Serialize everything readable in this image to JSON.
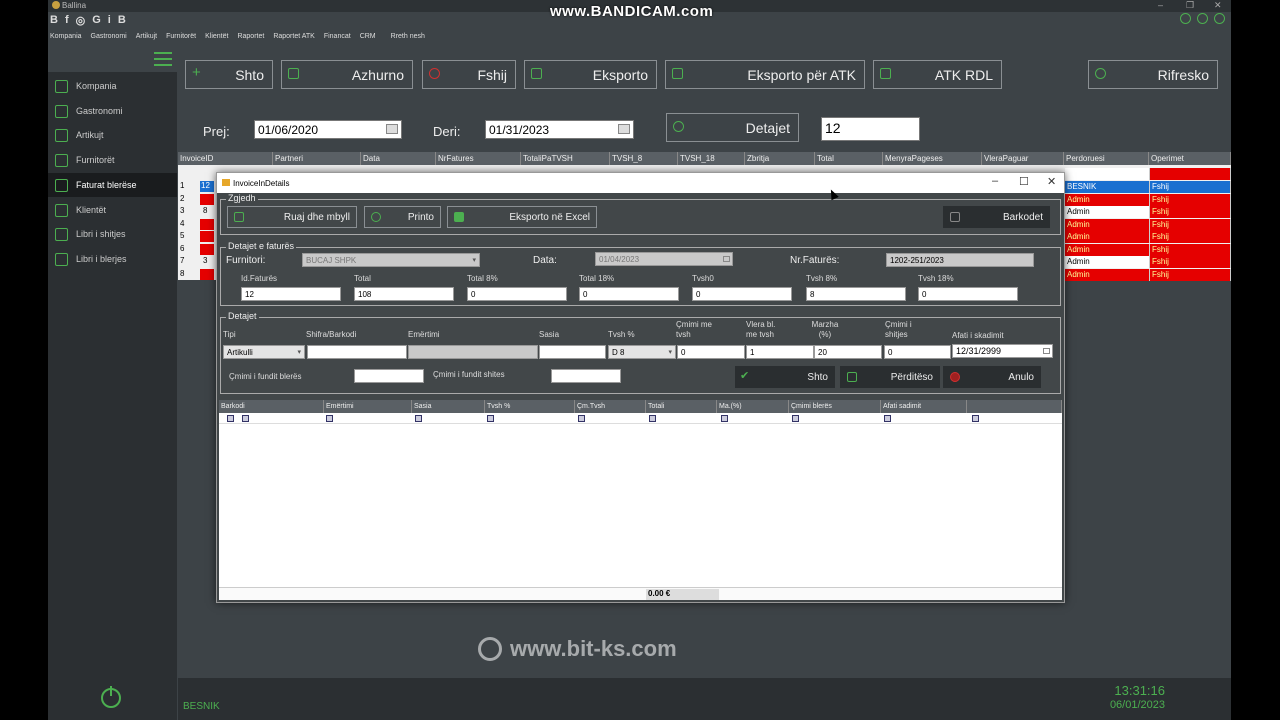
{
  "window": {
    "title": "Ballina"
  },
  "recording_watermark": "www.BANDICAM.com",
  "site_watermark": "www.bit-ks.com",
  "menubar": [
    "Kompania",
    "Gastronomi",
    "Artikujt",
    "Furnitorët",
    "Klientët",
    "Raportet",
    "Raportet ATK",
    "Financat",
    "CRM",
    "Rreth nesh"
  ],
  "social_icons": [
    "B",
    "f",
    "◎",
    "G",
    "i",
    "B"
  ],
  "sidebar": {
    "items": [
      {
        "label": "Kompania"
      },
      {
        "label": "Gastronomi"
      },
      {
        "label": "Artikujt"
      },
      {
        "label": "Furnitorët"
      },
      {
        "label": "Faturat blerëse"
      },
      {
        "label": "Klientët"
      },
      {
        "label": "Libri i shitjes"
      },
      {
        "label": "Libri i blerjes"
      }
    ],
    "active_index": 4
  },
  "toolbar": {
    "add": "Shto",
    "update": "Azhurno",
    "delete": "Fshij",
    "export": "Eksporto",
    "export_atk": "Eksporto për ATK",
    "atk_rdl": "ATK RDL",
    "refresh": "Rifresko"
  },
  "filter": {
    "from_label": "Prej:",
    "from_value": "01/06/2020",
    "to_label": "Deri:",
    "to_value": "01/31/2023",
    "details_button": "Detajet",
    "count_value": "12"
  },
  "main_grid": {
    "columns": [
      "InvoiceID",
      "Partneri",
      "Data",
      "NrFatures",
      "TotaliPaTVSH",
      "TVSH_8",
      "TVSH_18",
      "Zbritja",
      "Total",
      "MenyraPageses",
      "VleraPaguar",
      "Perdoruesi",
      "Operimet"
    ],
    "row_numbers": [
      "1",
      "2",
      "3",
      "4",
      "5",
      "6",
      "7",
      "8"
    ],
    "visible_ids": [
      "12",
      "",
      "8",
      "",
      "",
      "",
      "3",
      ""
    ],
    "users": [
      "BESNIK",
      "Admin",
      "Admin",
      "Admin",
      "Admin",
      "Admin",
      "Admin",
      "Admin"
    ],
    "operations": [
      "Fshij",
      "Fshij",
      "Fshij",
      "Fshij",
      "Fshij",
      "Fshij",
      "Fshij",
      "Fshij"
    ]
  },
  "dialog": {
    "title": "InvoiceInDetails",
    "group_choose": "Zgjedh",
    "save_close": "Ruaj dhe mbyll",
    "print": "Printo",
    "export_excel": "Eksporto në Excel",
    "barcodes": "Barkodet",
    "group_invoice": "Detajet e faturës",
    "supplier_label": "Furnitori:",
    "supplier_value": "BUCAJ SHPK",
    "date_label": "Data:",
    "date_value": "01/04/2023",
    "invoice_no_label": "Nr.Faturës:",
    "invoice_no_value": "1202-251/2023",
    "id_label": "Id.Faturës",
    "id_value": "12",
    "total_label": "Total",
    "total_value": "108",
    "total8_label": "Total 8%",
    "total8_value": "0",
    "total18_label": "Total 18%",
    "total18_value": "0",
    "tvsh0_label": "Tvsh0",
    "tvsh0_value": "0",
    "tvsh8_label": "Tvsh 8%",
    "tvsh8_value": "8",
    "tvsh18_label": "Tvsh 18%",
    "tvsh18_value": "0",
    "group_details": "Detajet",
    "type_label": "Tipi",
    "type_value": "Artikulli",
    "code_label": "Shifra/Barkodi",
    "name_label": "Emërtimi",
    "qty_label": "Sasia",
    "vat_label": "Tvsh %",
    "vat_value": "D 8",
    "price_label": "Çmimi me tvsh",
    "price_value": "0",
    "value_label": "Vlera bl. me tvsh",
    "value_value": "1",
    "margin_label": "Marzha (%)",
    "margin_value": "20",
    "sell_price_label": "Çmimi i shitjes",
    "sell_price_value": "0",
    "expiry_label": "Afati i skadimit",
    "expiry_value": "12/31/2999",
    "last_buy_label": "Çmimi i fundit blerës",
    "last_sell_label": "Çmimi i fundit shites",
    "add": "Shto",
    "update": "Përditëso",
    "cancel": "Anulo",
    "items_columns": [
      "Barkodi",
      "Emërtimi",
      "Sasia",
      "Tvsh %",
      "Çm.Tvsh",
      "Totali",
      "Ma.(%)",
      "Çmimi blerës",
      "Afati sadimit"
    ],
    "total_footer": "0.00 €"
  },
  "status": {
    "user": "BESNIK",
    "time": "13:31:16",
    "date": "06/01/2023"
  },
  "colors": {
    "accent": "#4caf50",
    "danger_row": "#e50000",
    "selected_row": "#1a6fd0",
    "background": "#3d4347"
  }
}
